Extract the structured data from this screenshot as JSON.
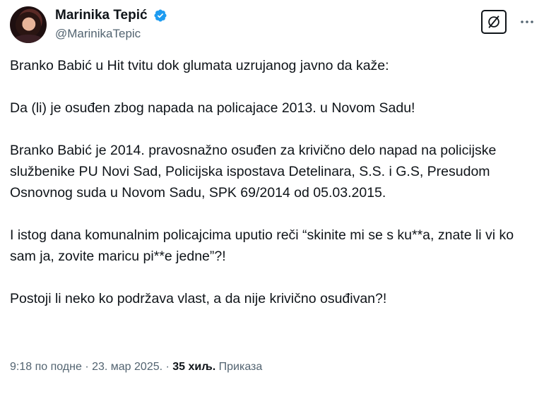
{
  "author": {
    "display_name": "Marinika Tepić",
    "handle": "@MarinikaTepic",
    "verified": true,
    "verified_color": "#1d9bf0"
  },
  "actions": {
    "grok_icon": "grok-icon",
    "more_icon": "more-icon"
  },
  "tweet": {
    "paragraphs": [
      "Branko Babić u Hit tvitu dok glumata uzrujanog javno da kaže:",
      "Da (li) je osuđen zbog napada na policajace 2013. u Novom Sadu!",
      "Branko Babić je 2014. pravosnažno osuđen za krivično delo napad na policijske službenike PU Novi Sad, Policijska ispostava Detelinara, S.S. i G.S, Presudom Osnovnog suda u Novom Sadu, SPK 69/2014 od 05.03.2015.",
      "I istog dana komunalnim policajcima uputio reči “skinite mi se s ku**a, znate li vi ko sam ja, zovite maricu pi**e jedne”?!",
      "Postoji li neko ko podržava vlast, a da nije krivično osuđivan?!"
    ]
  },
  "meta": {
    "time": "9:18 по подне",
    "separator": " · ",
    "date": "23. мар 2025.",
    "views_count": "35 хиљ.",
    "views_label": " Приказа"
  }
}
